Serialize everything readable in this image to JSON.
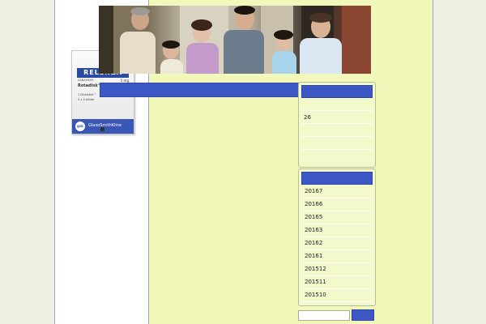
{
  "product": {
    "brand": "RELENZA",
    "subtitle": "ZANAMIVIR",
    "dose": "5 mg",
    "name": "Rotadisk™",
    "line1": "1 Diskhaler™",
    "line2": "5 x 4 blister",
    "maker_mark": "gsk",
    "maker": "GlaxoSmithKline"
  },
  "widget1": {
    "item": "26"
  },
  "archives": [
    "20167",
    "20166",
    "20165",
    "20163",
    "20162",
    "20161",
    "201512",
    "201511",
    "201510"
  ],
  "search": {
    "value": "",
    "button_label": ""
  },
  "colors": {
    "accent": "#3d57c4",
    "content_bg": "#f2f8b9",
    "page_bg": "#eef1df"
  }
}
